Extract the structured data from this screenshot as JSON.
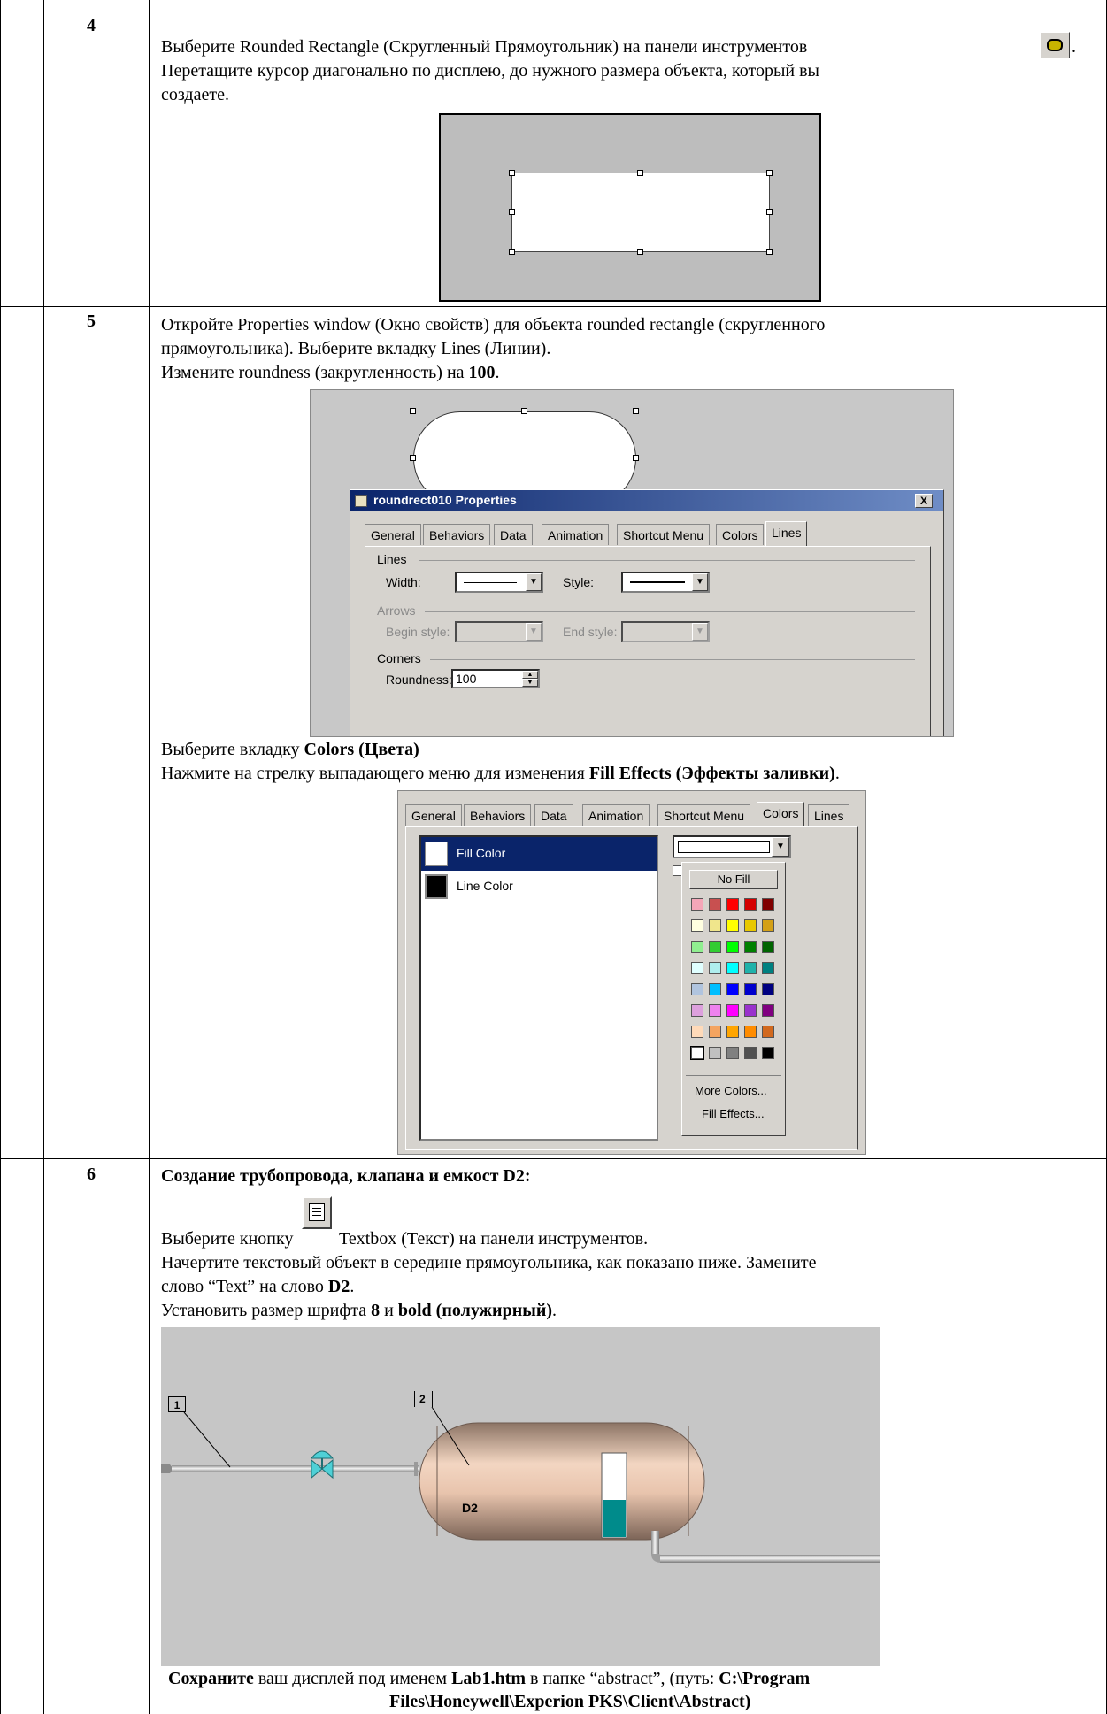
{
  "rows": [
    {
      "number": "4",
      "line1": "Выберите Rounded Rectangle (Скругленный Прямоугольник) на панели инструментов",
      "line1_end": ".",
      "line2": "Перетащите курсор диагонально по дисплею, до нужного размера объекта, который вы",
      "line3": "создаете."
    },
    {
      "number": "5",
      "line1": "Откройте Properties window (Окно свойств) для объекта rounded rectangle (скругленного",
      "line2": "прямоугольника). Выберите вкладку Lines (Линии).",
      "line3_pre": "Измените roundness (закругленность) на ",
      "line3_bold": "100",
      "line3_post": ".",
      "line4_pre": "Выберите вкладку ",
      "line4_bold": "Colors (Цвета)",
      "line5_pre": "Нажмите на стрелку выпадающего меню для изменения ",
      "line5_bold": "Fill Effects (Эффекты заливки)",
      "line5_post": "."
    },
    {
      "number": "6",
      "heading": "Создание трубопровода, клапана  и емкост D2:",
      "line1_pre": "Выберите кнопку",
      "line1_post": "Textbox (Текст) на панели инструментов.",
      "line2": "Начертите текстовый объект в середине прямоугольника, как показано ниже. Замените",
      "line3_pre": "слово “Text” на слово ",
      "line3_bold": "D2",
      "line3_post": ".",
      "line4_pre": "Установить размер шрифта ",
      "line4_b1": "8",
      "line4_mid": " и ",
      "line4_b2": "bold (полужирный)",
      "line4_post": ".",
      "save_b1": "Сохраните",
      "save_mid1": " ваш дисплей под именем ",
      "save_b2": "Lab1.htm",
      "save_mid2": " в папке “abstract”, (путь: ",
      "save_b3": "C:\\Program",
      "save_line2": "Files\\Honeywell\\Experion PKS\\Client\\Abstract)"
    }
  ],
  "props_dialog": {
    "title": "roundrect010 Properties",
    "close": "X",
    "tabs": [
      "General",
      "Behaviors",
      "Data",
      "Animation",
      "Shortcut Menu",
      "Colors",
      "Lines"
    ],
    "lines_group": "Lines",
    "width_label": "Width:",
    "style_label": "Style:",
    "arrows_group": "Arrows",
    "begin_label": "Begin style:",
    "end_label": "End style:",
    "corners_group": "Corners",
    "roundness_label": "Roundness:",
    "roundness_value": "100"
  },
  "colors_dialog": {
    "tabs": [
      "General",
      "Behaviors",
      "Data",
      "Animation",
      "Shortcut Menu",
      "Colors",
      "Lines"
    ],
    "list": [
      "Fill Color",
      "Line Color"
    ],
    "no_fill": "No Fill",
    "more_colors": "More Colors...",
    "fill_effects": "Fill Effects...",
    "palette": [
      [
        "#f4a6b8",
        "#c85050",
        "#ff0000",
        "#d40000",
        "#800000"
      ],
      [
        "#ffffe0",
        "#f0e68c",
        "#ffff00",
        "#e8c800",
        "#d4a017"
      ],
      [
        "#90ee90",
        "#32cd32",
        "#00ff00",
        "#008000",
        "#006400"
      ],
      [
        "#e0ffff",
        "#afeeee",
        "#00ffff",
        "#20b2aa",
        "#008080"
      ],
      [
        "#b0c4de",
        "#00bfff",
        "#0000ff",
        "#0000cd",
        "#000080"
      ],
      [
        "#dda0dd",
        "#ee82ee",
        "#ff00ff",
        "#9932cc",
        "#800080"
      ],
      [
        "#ffdab9",
        "#f4a460",
        "#ffa500",
        "#ff8c00",
        "#d2691e"
      ],
      [
        "#ffffff",
        "#c0c0c0",
        "#808080",
        "#505050",
        "#000000"
      ]
    ]
  },
  "diagram": {
    "label1": "1",
    "label2": "2",
    "tank_text": "D2",
    "level": 0.45
  }
}
